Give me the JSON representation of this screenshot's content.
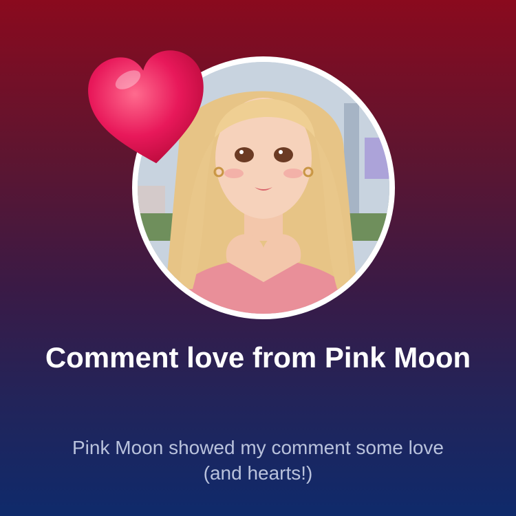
{
  "card": {
    "title": "Comment love from Pink Moon",
    "subtitle": "Pink Moon showed my comment some love (and hearts!)",
    "avatar_icon": "profile-avatar",
    "badge_icon": "heart-icon"
  },
  "colors": {
    "background_top": "#8a0a1e",
    "background_bottom": "#0f2a6b",
    "heart": "#e8185a",
    "title": "#ffffff",
    "subtitle": "#b9c2dc"
  }
}
